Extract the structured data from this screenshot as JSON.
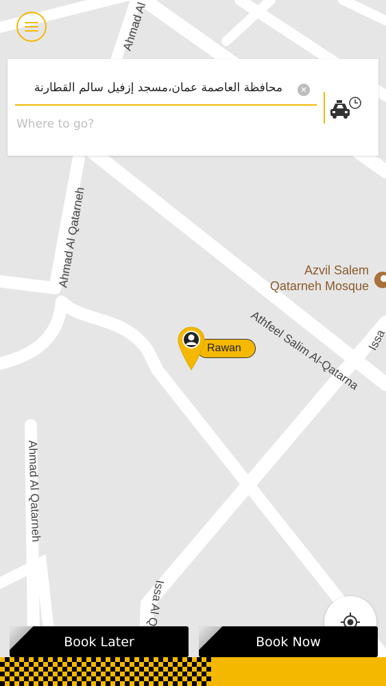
{
  "map": {
    "roads": {
      "ahmad_top": "Ahmad Al",
      "ahmad_mid": "Ahmad Al Qatarneh",
      "ahmad_low": "Ahmad Al Qatarneh",
      "athfeel": "Athfeel Salim Al-Qatarna",
      "issa_right": "Issa",
      "issa_bottom": "Issa Al Q"
    },
    "poi": {
      "name_line1": "Azvil Salem",
      "name_line2": "Qatarneh Mosque",
      "icon": "mosque-icon"
    },
    "driver": {
      "name": "Rawan"
    }
  },
  "search": {
    "pickup_value": "محافظة العاصمة عمان،مسجد إزفيل سالم القطارنة",
    "destination_placeholder": "Where to go?"
  },
  "buttons": {
    "book_later": "Book Later",
    "book_now": "Book Now"
  },
  "colors": {
    "accent": "#f5b800",
    "map_bg": "#e6e6e6",
    "road": "#ffffff"
  }
}
